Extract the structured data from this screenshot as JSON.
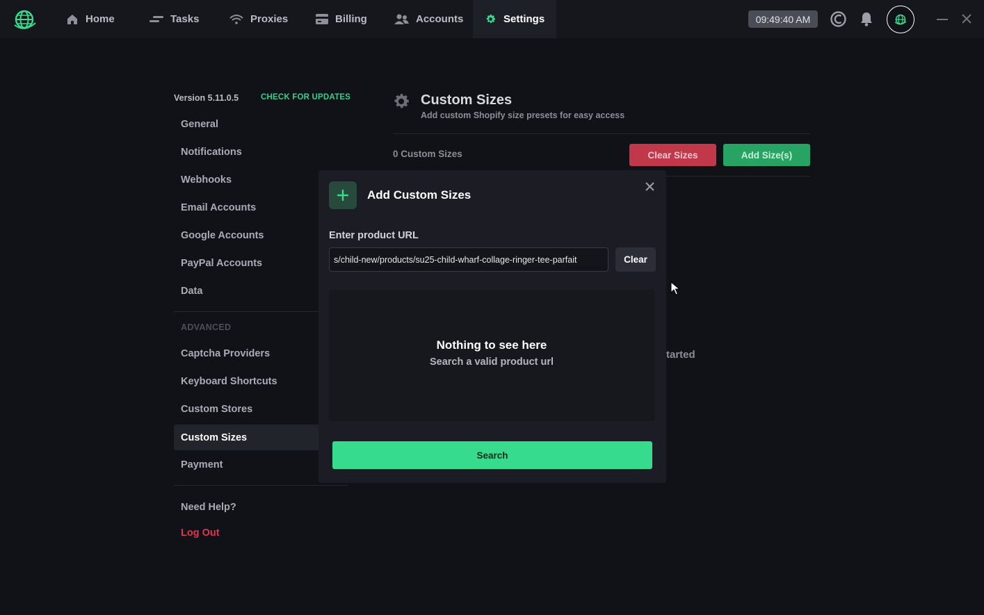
{
  "nav": {
    "items": [
      {
        "label": "Home",
        "icon": "home-icon"
      },
      {
        "label": "Tasks",
        "icon": "tasks-icon"
      },
      {
        "label": "Proxies",
        "icon": "wifi-icon"
      },
      {
        "label": "Billing",
        "icon": "card-icon"
      },
      {
        "label": "Accounts",
        "icon": "users-icon"
      },
      {
        "label": "Settings",
        "icon": "gear-icon",
        "active": true
      }
    ],
    "clock": "09:49:40 AM"
  },
  "sidebar": {
    "version": "Version 5.11.0.5",
    "check_updates": "CHECK FOR UPDATES",
    "items": [
      "General",
      "Notifications",
      "Webhooks",
      "Email Accounts",
      "Google Accounts",
      "PayPal Accounts",
      "Data"
    ],
    "advanced_label": "ADVANCED",
    "advanced_items": [
      "Captcha Providers",
      "Keyboard Shortcuts",
      "Custom Stores",
      "Custom Sizes",
      "Payment"
    ],
    "active": "Custom Sizes",
    "help": "Need Help?",
    "logout": "Log Out"
  },
  "main": {
    "title": "Custom Sizes",
    "subtitle": "Add custom Shopify size presets for easy access",
    "count_label": "0 Custom Sizes",
    "clear_sizes": "Clear Sizes",
    "add_sizes": "Add Size(s)",
    "background_text": "tarted"
  },
  "modal": {
    "title": "Add Custom Sizes",
    "url_label": "Enter product URL",
    "url_value": "s/child-new/products/su25-child-wharf-collage-ringer-tee-parfait",
    "clear_label": "Clear",
    "empty_title": "Nothing to see here",
    "empty_sub": "Search a valid product url",
    "search_label": "Search"
  },
  "colors": {
    "accent": "#36db8d",
    "danger": "#c2384b",
    "background": "#111217"
  }
}
